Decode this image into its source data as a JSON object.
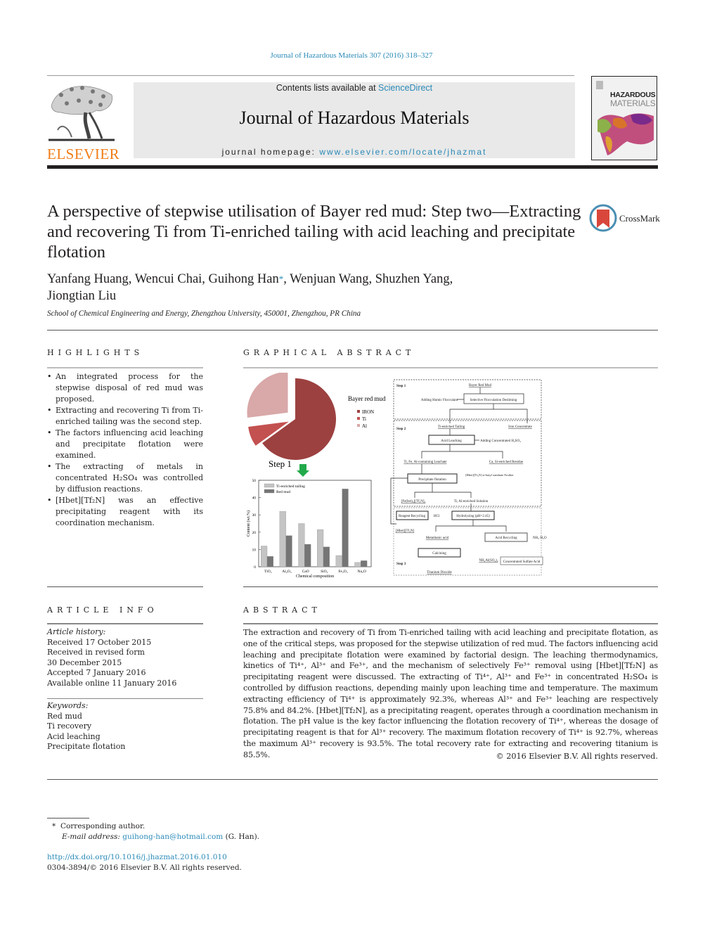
{
  "header": {
    "journal_ref": "Journal of Hazardous Materials 307 (2016) 318–327",
    "contents_prefix": "Contents lists available at ",
    "contents_link": "ScienceDirect",
    "journal_title": "Journal of Hazardous Materials",
    "homepage_prefix": "journal homepage: ",
    "homepage_link": "www.elsevier.com/locate/jhazmat",
    "publisher_logo_text": "ELSEVIER",
    "cover_title_line1": "HAZARDOUS",
    "cover_title_line2": "MATERIALS"
  },
  "article": {
    "title": "A perspective of stepwise utilisation of Bayer red mud: Step two—Extracting and recovering Ti from Ti-enriched tailing with acid leaching and precipitate flotation",
    "crossmark_label": "CrossMark",
    "authors_part1": "Yanfang Huang, Wencui Chai, Guihong Han",
    "author_marker": "*",
    "authors_part2": ", Wenjuan Wang, Shuzhen Yang,",
    "authors_line2": "Jiongtian Liu",
    "affiliation": "School of Chemical Engineering and Energy, Zhengzhou University, 450001, Zhengzhou, PR China"
  },
  "highlights": {
    "heading": "HIGHLIGHTS",
    "items": [
      "An integrated process for the stepwise disposal of red mud was proposed.",
      "Extracting and recovering Ti from Ti-enriched tailing was the second step.",
      "The factors influencing acid leaching and precipitate flotation were examined.",
      "The extracting of metals in concentrated H₂SO₄ was controlled by diffusion reactions.",
      "[Hbet][Tf₂N] was an effective precipitating reagent with its coordination mechanism."
    ]
  },
  "graphical_abstract": {
    "heading": "GRAPHICAL ABSTRACT",
    "step1_label": "Step 1",
    "flowchart": {
      "step1": "Step 1",
      "step2": "Step 2",
      "step3": "Step 3",
      "nodes": {
        "bayer_red_mud": "Bayer Red Mud",
        "adding_flocculant": "Adding Humic Flocculant",
        "selective_flocculation": "Selective Flocculation Desliming",
        "ti_enriched_tailing": "Ti-enriched Tailing",
        "iron_concentrate": "Iron Concentrate",
        "acid_leaching": "Acid Leaching",
        "adding_h2so4": "Adding Concentrated H₂SO₄",
        "leachate": "Ti, Fe, Al-containing Leachate",
        "ca_si_residue": "Ca, Si-enriched Residue",
        "precipitate_flotation": "Precipitate flotation",
        "reagents": "[Hbet][Tf₂N] n-butyl xanthate Frother",
        "fe_complex": "[Fe(bet)₃][Tf₂N]₃",
        "ti_al_solution": "Ti, Al-enriched Solution",
        "reagent_recycling": "Reagent Recycling",
        "hcl": "HCl",
        "hydrolyzing": "Hydrolyzing (pH=2.45)",
        "hbet_tf2n": "[Hbet][Tf₂N]",
        "metatitanic_acid": "Metatitanic acid",
        "acid_recycling": "Acid Recycling",
        "nh3_h2o": "NH₃·H₂O",
        "calcining": "Calcining",
        "nh4al_so4": "NH₄Al(SO₄)₂",
        "concentrated_acid": "Concentrated Sulfate Acid",
        "titanium_dioxide": "Titanium Dioxide"
      }
    }
  },
  "chart_data": [
    {
      "type": "pie",
      "title": "Bayer red mud",
      "legend_position": "right",
      "categories": [
        "IRON",
        "Ti",
        "Al"
      ],
      "values": [
        65,
        8,
        27
      ],
      "colors": [
        "#9c4140",
        "#c25150",
        "#d9a8a8"
      ]
    },
    {
      "type": "bar",
      "title": "",
      "xlabel": "Chemical composition",
      "ylabel": "Content (wt.%)",
      "ylim": [
        0,
        50
      ],
      "yticks": [
        0,
        10,
        20,
        30,
        40,
        50
      ],
      "categories": [
        "TiO₂",
        "Al₂O₃",
        "CaO",
        "SiO₂",
        "Fe₂O₃",
        "Na₂O"
      ],
      "legend_position": "top-left",
      "series": [
        {
          "name": "Ti-enriched tailing",
          "color": "#c4c4c4",
          "values": [
            12,
            32,
            25,
            21.5,
            6.5,
            2.5
          ]
        },
        {
          "name": "Red mud",
          "color": "#757575",
          "values": [
            6,
            18,
            13,
            11.5,
            45,
            3.5
          ]
        }
      ]
    }
  ],
  "article_info": {
    "heading": "ARTICLE INFO",
    "history_label": "Article history:",
    "history": [
      "Received 17 October 2015",
      "Received in revised form",
      "30 December 2015",
      "Accepted 7 January 2016",
      "Available online 11 January 2016"
    ],
    "keywords_label": "Keywords:",
    "keywords": [
      "Red mud",
      "Ti recovery",
      "Acid leaching",
      "Precipitate flotation"
    ]
  },
  "abstract": {
    "heading": "ABSTRACT",
    "text": "The extraction and recovery of Ti from Ti-enriched tailing with acid leaching and precipitate flotation, as one of the critical steps, was proposed for the stepwise utilization of red mud. The factors influencing acid leaching and precipitate flotation were examined by factorial design. The leaching thermodynamics, kinetics of Ti⁴⁺, Al³⁺ and Fe³⁺, and the mechanism of selectively Fe³⁺ removal using [Hbet][Tf₂N] as precipitating reagent were discussed. The extracting of Ti⁴⁺, Al³⁺ and Fe³⁺ in concentrated H₂SO₄ is controlled by diffusion reactions, depending mainly upon leaching time and temperature. The maximum extracting efficiency of Ti⁴⁺ is approximately 92.3%, whereas Al³⁺ and Fe³⁺ leaching are respectively 75.8% and 84.2%. [Hbet][Tf₂N], as a precipitating reagent, operates through a coordination mechanism in flotation. The pH value is the key factor influencing the flotation recovery of Ti⁴⁺, whereas the dosage of precipitating reagent is that for Al³⁺ recovery. The maximum flotation recovery of Ti⁴⁺ is 92.7%, whereas the maximum Al³⁺ recovery is 93.5%. The total recovery rate for extracting and recovering titanium is 85.5%.",
    "copyright": "© 2016 Elsevier B.V. All rights reserved."
  },
  "footer": {
    "footnote_marker": "*",
    "corresponding": "Corresponding author.",
    "email_label": "E-mail address: ",
    "email": "guihong-han@hotmail.com",
    "email_suffix": " (G. Han).",
    "doi": "http://dx.doi.org/10.1016/j.jhazmat.2016.01.010",
    "issn_copyright": "0304-3894/© 2016 Elsevier B.V. All rights reserved."
  }
}
